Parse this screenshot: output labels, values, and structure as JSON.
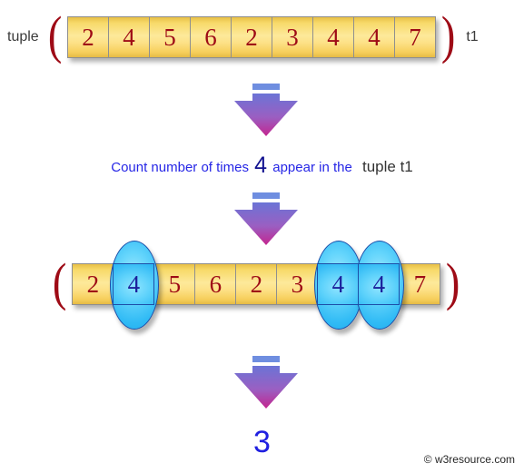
{
  "diagram": {
    "title": "Count number of times 4 appear in the tuple t1",
    "accent_yellow": "#fde99a",
    "accent_highlight": "#31bbf5",
    "paren_color": "#9e0b16",
    "digit_color": "#9e0b16",
    "highlight_digit_color": "#1c219c",
    "caption_color": "#2626e6",
    "result_color": "#2020e0"
  },
  "top_row": {
    "left_label": "tuple",
    "open_paren": "(",
    "close_paren": ")",
    "right_label": "t1",
    "values": [
      "2",
      "4",
      "5",
      "6",
      "2",
      "3",
      "4",
      "4",
      "7"
    ]
  },
  "caption": {
    "prefix": "Count number of times",
    "needle": "4",
    "middle": "appear in the",
    "subject": "tuple t1"
  },
  "bottom_row": {
    "open_paren": "(",
    "close_paren": ")",
    "values": [
      "2",
      "4",
      "5",
      "6",
      "2",
      "3",
      "4",
      "4",
      "7"
    ],
    "highlighted_indexes": [
      1,
      6,
      7
    ]
  },
  "result": {
    "value": "3"
  },
  "footer": {
    "text": "© w3resource.com"
  },
  "arrows": {
    "count": 3,
    "direction": "down",
    "gradient_top": "#6b74d6",
    "gradient_bottom": "#c4258f",
    "cap_color": "#6f8ee0"
  }
}
